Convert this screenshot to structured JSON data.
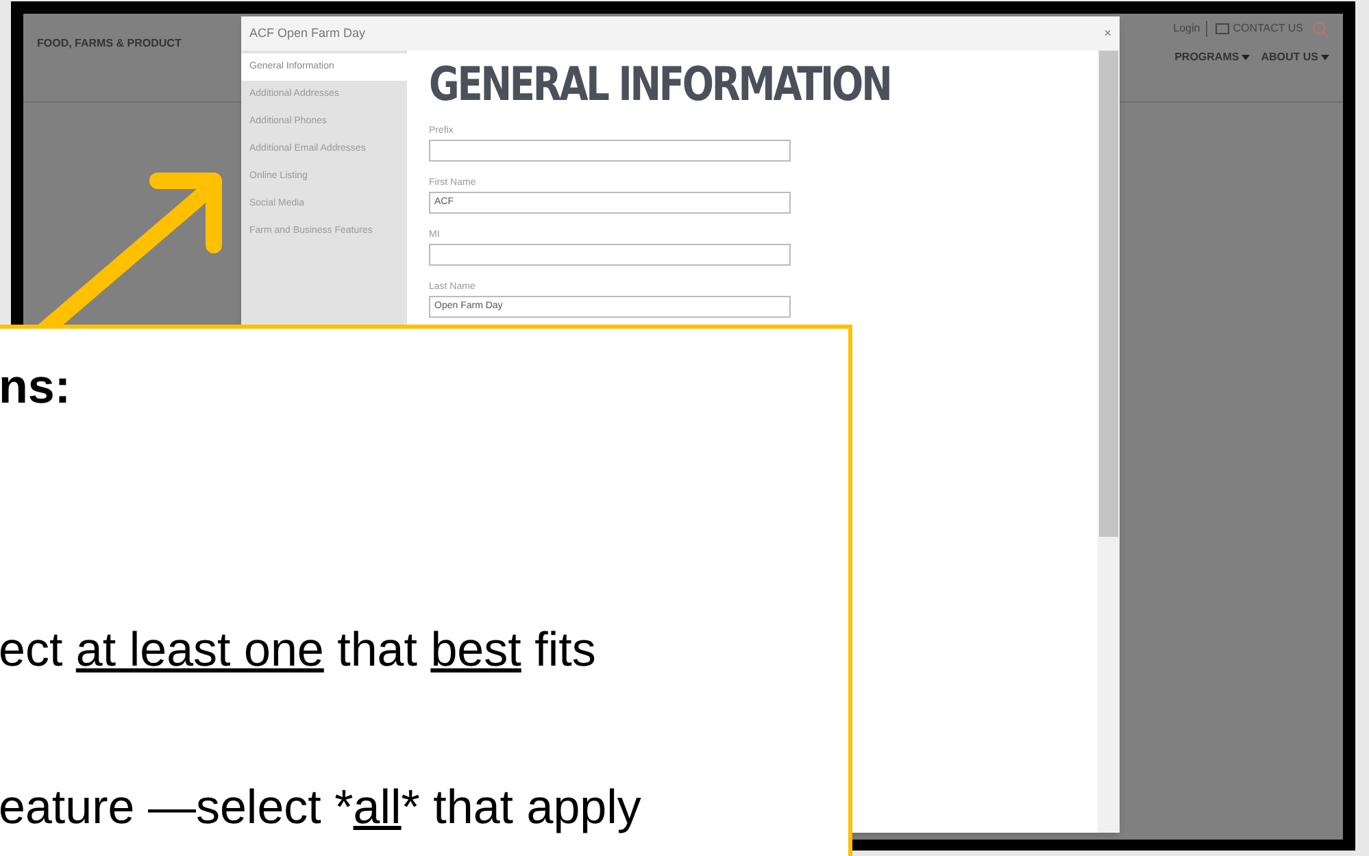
{
  "site_header": {
    "brand_nav": "FOOD, FARMS & PRODUCT",
    "top_links": [
      {
        "label": "Login"
      },
      {
        "label": "CONTACT US"
      }
    ],
    "nav": [
      {
        "label": "PROGRAMS"
      },
      {
        "label": "ABOUT US"
      }
    ]
  },
  "modal": {
    "title": "ACF Open Farm Day",
    "close": "×",
    "sidebar": [
      {
        "label": "General Information",
        "selected": true
      },
      {
        "label": "Additional Addresses",
        "selected": false
      },
      {
        "label": "Additional Phones",
        "selected": false
      },
      {
        "label": "Additional Email Addresses",
        "selected": false
      },
      {
        "label": "Online Listing",
        "selected": false
      },
      {
        "label": "Social Media",
        "selected": false
      },
      {
        "label": "Farm and Business Features",
        "selected": false
      }
    ],
    "heading": "GENERAL INFORMATION",
    "fields": [
      {
        "label": "Prefix"
      },
      {
        "label": "First Name",
        "value": "ACF"
      },
      {
        "label": "MI"
      },
      {
        "label": "Last Name",
        "value": "Open Farm Day"
      }
    ]
  },
  "callout": {
    "lines": [
      {
        "kind": "heading",
        "segments": [
          {
            "text": "ns:",
            "underline": false
          }
        ]
      },
      {
        "kind": "body",
        "segments": [
          {
            "text": "ect ",
            "underline": false
          },
          {
            "text": "at least one",
            "underline": true
          },
          {
            "text": " that ",
            "underline": false
          },
          {
            "text": "best",
            "underline": true
          },
          {
            "text": " fits",
            "underline": false
          }
        ]
      },
      {
        "kind": "body",
        "segments": [
          {
            "text": "eature —select *",
            "underline": false
          },
          {
            "text": "all",
            "underline": true
          },
          {
            "text": "* that apply",
            "underline": false
          }
        ]
      }
    ]
  }
}
